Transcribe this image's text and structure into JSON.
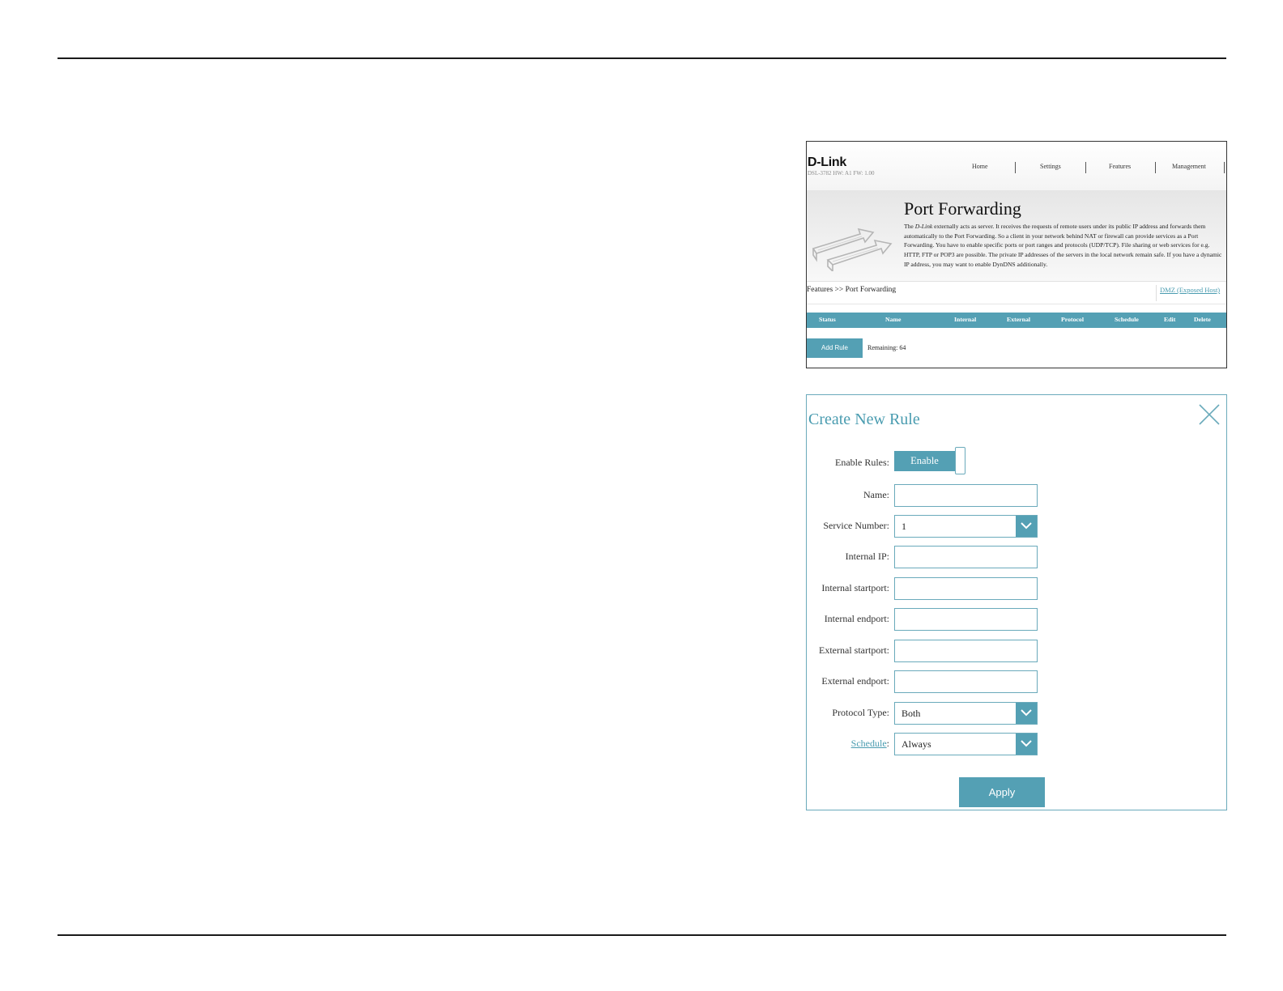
{
  "port_forwarding_panel": {
    "logo": "D-Link",
    "model_info": "DSL-3782  HW: A1  FW: 1.00",
    "nav": [
      "Home",
      "Settings",
      "Features",
      "Management"
    ],
    "title": "Port Forwarding",
    "description_prefix": "The ",
    "description_brand": "D-Link",
    "description_rest": " externally acts as server. It receives the requests of remote users under its public IP address and forwards them automatically to the Port Forwarding. So a client in your network behind NAT or firewall can provide services as a Port Forwarding. You have to enable specific ports or port ranges and protocols (UDP/TCP). File sharing or web services for e.g. HTTP, FTP or POP3 are possible. The private IP addresses of the servers in the local network remain safe. If you have a dynamic IP address, you may want to enable DynDNS additionally.",
    "breadcrumb": "Features >> Port Forwarding",
    "dmz_link": "DMZ (Exposed Host)",
    "table_headers": [
      "Status",
      "Name",
      "Internal",
      "External",
      "Protocol",
      "Schedule",
      "Edit",
      "Delete"
    ],
    "add_rule_label": "Add Rule",
    "remaining": "Remaining: 64"
  },
  "create_rule_panel": {
    "title": "Create New Rule",
    "enable_rules_label": "Enable Rules:",
    "enable_state": "Enable",
    "name_label": "Name:",
    "name_value": "",
    "service_number_label": "Service Number:",
    "service_number_value": "1",
    "internal_ip_label": "Internal IP:",
    "internal_ip_value": "",
    "internal_startport_label": "Internal startport:",
    "internal_startport_value": "",
    "internal_endport_label": "Internal endport:",
    "internal_endport_value": "",
    "external_startport_label": "External startport:",
    "external_startport_value": "",
    "external_endport_label": "External endport:",
    "external_endport_value": "",
    "protocol_type_label": "Protocol Type:",
    "protocol_type_value": "Both",
    "schedule_label": "Schedule",
    "schedule_value": "Always",
    "apply_label": "Apply"
  },
  "colors": {
    "accent": "#54a0b4",
    "accent_border": "#6aaabb",
    "title": "#4a9cb0"
  }
}
